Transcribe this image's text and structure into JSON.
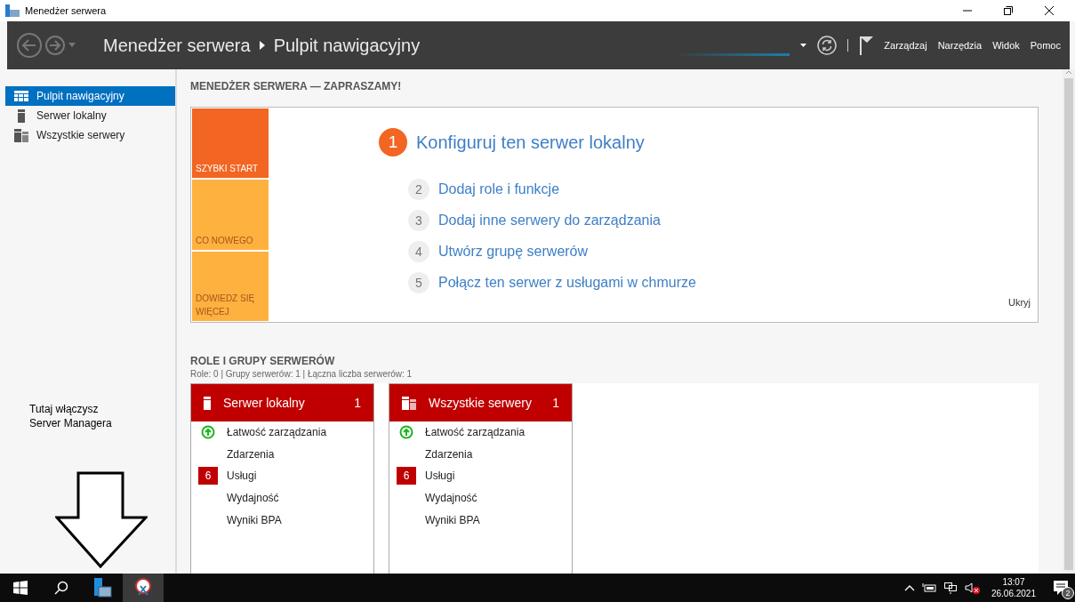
{
  "window": {
    "title": "Menedżer serwera"
  },
  "header": {
    "breadcrumb": [
      {
        "label": "Menedżer serwera"
      },
      {
        "label": "Pulpit nawigacyjny"
      }
    ],
    "menu": [
      "Zarządzaj",
      "Narzędzia",
      "Widok",
      "Pomoc"
    ]
  },
  "sidebar": {
    "items": [
      {
        "label": "Pulpit nawigacyjny",
        "kind": "dashboard",
        "selected": true
      },
      {
        "label": "Serwer lokalny",
        "kind": "server",
        "selected": false
      },
      {
        "label": "Wszystkie serwery",
        "kind": "servers",
        "selected": false
      }
    ]
  },
  "annotation": {
    "text": "Tutaj włączysz Server Managera"
  },
  "welcome": {
    "title": "MENEDŻER SERWERA — ZAPRASZAMY!",
    "tiles": [
      {
        "label": "SZYBKI START",
        "color": "#f26522",
        "selected": true
      },
      {
        "label": "CO NOWEGO",
        "color": "#ffb140",
        "selected": false
      },
      {
        "label": "DOWIEDZ SIĘ WIĘCEJ",
        "color": "#ffb140",
        "selected": false
      }
    ],
    "steps": [
      {
        "number": "1",
        "label": "Konfiguruj ten serwer lokalny",
        "selected": true
      },
      {
        "number": "2",
        "label": "Dodaj role i funkcje",
        "selected": false
      },
      {
        "number": "3",
        "label": "Dodaj inne serwery do zarządzania",
        "selected": false
      },
      {
        "number": "4",
        "label": "Utwórz grupę serwerów",
        "selected": false
      },
      {
        "number": "5",
        "label": "Połącz ten serwer z usługami w chmurze",
        "selected": false
      }
    ],
    "hide": "Ukryj"
  },
  "roles": {
    "title": "ROLE I GRUPY SERWERÓW",
    "summary": "Role: 0 | Grupy serwerów: 1 | Łączna liczba serwerów: 1",
    "cards": [
      {
        "title": "Serwer lokalny",
        "kind": "server",
        "count": "1",
        "items": [
          {
            "label": "Łatwość zarządzania",
            "kind": "healthy"
          },
          {
            "label": "Zdarzenia",
            "kind": "plain"
          },
          {
            "label": "Usługi",
            "kind": "alert",
            "badge": "6"
          },
          {
            "label": "Wydajność",
            "kind": "plain"
          },
          {
            "label": "Wyniki BPA",
            "kind": "plain"
          }
        ]
      },
      {
        "title": "Wszystkie serwery",
        "kind": "servers",
        "count": "1",
        "items": [
          {
            "label": "Łatwość zarządzania",
            "kind": "healthy"
          },
          {
            "label": "Zdarzenia",
            "kind": "plain"
          },
          {
            "label": "Usługi",
            "kind": "alert",
            "badge": "6"
          },
          {
            "label": "Wydajność",
            "kind": "plain"
          },
          {
            "label": "Wyniki BPA",
            "kind": "plain"
          }
        ]
      }
    ]
  },
  "taskbar": {
    "time": "13:07",
    "date": "26.06.2021",
    "notifications": "2"
  }
}
